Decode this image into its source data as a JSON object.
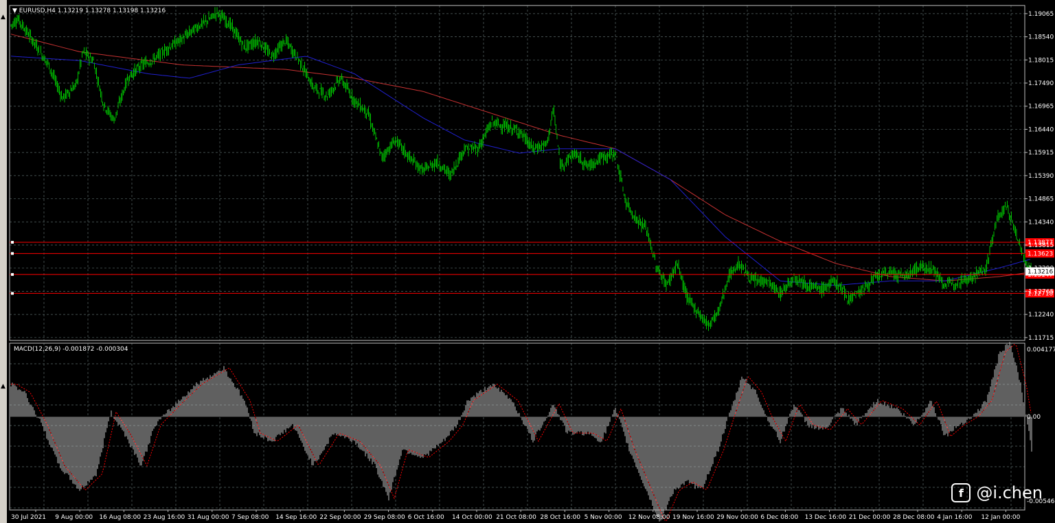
{
  "header": {
    "collapse_icon": "triangle-down-icon",
    "symbol": "EURUSD,H4",
    "quote": "1.13219 1.13278 1.13198 1.13216"
  },
  "price_axis": {
    "ticks": [
      "1.19065",
      "1.18540",
      "1.18015",
      "1.17490",
      "1.16965",
      "1.16440",
      "1.15915",
      "1.15390",
      "1.14865",
      "1.14340",
      "1.13815",
      "1.13290",
      "1.12765",
      "1.12240",
      "1.11715"
    ],
    "current_price": "1.13216"
  },
  "lines": [
    {
      "label": "1.13877",
      "color": "#ff0000"
    },
    {
      "label": "1.13623",
      "color": "#ff0000"
    },
    {
      "label": "1.13147",
      "color": "#ff0000"
    },
    {
      "label": "1.12718",
      "color": "#ff0000"
    }
  ],
  "macd": {
    "label": "MACD(12,26,9) -0.001872 -0.000304",
    "axis": [
      "0.004177",
      "0.00",
      "-0.005461"
    ]
  },
  "time_axis": [
    "30 Jul 2021",
    "9 Aug 00:00",
    "16 Aug 08:00",
    "23 Aug 16:00",
    "31 Aug 00:00",
    "7 Sep 08:00",
    "14 Sep 16:00",
    "22 Sep 00:00",
    "29 Sep 08:00",
    "6 Oct 16:00",
    "14 Oct 00:00",
    "21 Oct 08:00",
    "28 Oct 16:00",
    "5 Nov 00:00",
    "12 Nov 08:00",
    "19 Nov 16:00",
    "29 Nov 00:00",
    "6 Dec 08:00",
    "13 Dec 16:00",
    "21 Dec 00:00",
    "28 Dec 08:00",
    "4 Jan 16:00",
    "12 Jan 00:00"
  ],
  "colors": {
    "candles": "#00c000",
    "ma_fast": "#2020d0",
    "ma_slow": "#c83232",
    "grid": "#5a6a6a",
    "hist": "#c0c0c0",
    "signal": "#ff0000"
  },
  "chart_data": {
    "type": "line",
    "title": "EURUSD,H4",
    "ylim": [
      1.1165,
      1.1925
    ],
    "price_anchors": [
      [
        0,
        1.188
      ],
      [
        10,
        1.1895
      ],
      [
        30,
        1.185
      ],
      [
        55,
        1.179
      ],
      [
        75,
        1.1715
      ],
      [
        95,
        1.1745
      ],
      [
        105,
        1.182
      ],
      [
        120,
        1.18
      ],
      [
        135,
        1.17
      ],
      [
        150,
        1.1665
      ],
      [
        170,
        1.176
      ],
      [
        190,
        1.179
      ],
      [
        205,
        1.18
      ],
      [
        230,
        1.183
      ],
      [
        250,
        1.185
      ],
      [
        270,
        1.1875
      ],
      [
        290,
        1.1895
      ],
      [
        300,
        1.191
      ],
      [
        320,
        1.188
      ],
      [
        340,
        1.183
      ],
      [
        360,
        1.1845
      ],
      [
        380,
        1.181
      ],
      [
        400,
        1.1845
      ],
      [
        420,
        1.18
      ],
      [
        440,
        1.174
      ],
      [
        460,
        1.172
      ],
      [
        480,
        1.176
      ],
      [
        500,
        1.171
      ],
      [
        520,
        1.168
      ],
      [
        540,
        1.158
      ],
      [
        560,
        1.162
      ],
      [
        580,
        1.158
      ],
      [
        600,
        1.155
      ],
      [
        620,
        1.157
      ],
      [
        640,
        1.154
      ],
      [
        660,
        1.16
      ],
      [
        680,
        1.16
      ],
      [
        700,
        1.166
      ],
      [
        720,
        1.165
      ],
      [
        740,
        1.164
      ],
      [
        760,
        1.16
      ],
      [
        780,
        1.161
      ],
      [
        790,
        1.169
      ],
      [
        800,
        1.156
      ],
      [
        820,
        1.159
      ],
      [
        840,
        1.156
      ],
      [
        860,
        1.158
      ],
      [
        880,
        1.159
      ],
      [
        895,
        1.148
      ],
      [
        910,
        1.144
      ],
      [
        925,
        1.142
      ],
      [
        940,
        1.133
      ],
      [
        955,
        1.129
      ],
      [
        970,
        1.134
      ],
      [
        985,
        1.126
      ],
      [
        1000,
        1.123
      ],
      [
        1015,
        1.12
      ],
      [
        1030,
        1.123
      ],
      [
        1045,
        1.131
      ],
      [
        1060,
        1.134
      ],
      [
        1080,
        1.13
      ],
      [
        1100,
        1.13
      ],
      [
        1120,
        1.127
      ],
      [
        1140,
        1.131
      ],
      [
        1160,
        1.129
      ],
      [
        1180,
        1.128
      ],
      [
        1200,
        1.13
      ],
      [
        1220,
        1.126
      ],
      [
        1240,
        1.128
      ],
      [
        1260,
        1.131
      ],
      [
        1280,
        1.132
      ],
      [
        1300,
        1.131
      ],
      [
        1320,
        1.133
      ],
      [
        1340,
        1.133
      ],
      [
        1360,
        1.129
      ],
      [
        1380,
        1.13
      ],
      [
        1400,
        1.131
      ],
      [
        1420,
        1.133
      ],
      [
        1435,
        1.144
      ],
      [
        1450,
        1.147
      ],
      [
        1465,
        1.14
      ],
      [
        1480,
        1.133
      ],
      [
        1486,
        1.1321
      ]
    ],
    "ma_fast": [
      [
        0,
        1.181
      ],
      [
        100,
        1.18
      ],
      [
        200,
        1.177
      ],
      [
        260,
        1.176
      ],
      [
        330,
        1.179
      ],
      [
        430,
        1.181
      ],
      [
        500,
        1.177
      ],
      [
        600,
        1.167
      ],
      [
        660,
        1.162
      ],
      [
        740,
        1.159
      ],
      [
        800,
        1.16
      ],
      [
        880,
        1.16
      ],
      [
        960,
        1.153
      ],
      [
        1040,
        1.14
      ],
      [
        1120,
        1.13
      ],
      [
        1200,
        1.129
      ],
      [
        1280,
        1.13
      ],
      [
        1360,
        1.13
      ],
      [
        1440,
        1.133
      ],
      [
        1486,
        1.135
      ]
    ],
    "ma_slow": [
      [
        0,
        1.186
      ],
      [
        100,
        1.182
      ],
      [
        250,
        1.179
      ],
      [
        400,
        1.178
      ],
      [
        500,
        1.176
      ],
      [
        600,
        1.173
      ],
      [
        700,
        1.168
      ],
      [
        800,
        1.163
      ],
      [
        880,
        1.16
      ],
      [
        960,
        1.153
      ],
      [
        1040,
        1.145
      ],
      [
        1120,
        1.139
      ],
      [
        1200,
        1.134
      ],
      [
        1280,
        1.131
      ],
      [
        1360,
        1.13
      ],
      [
        1440,
        1.131
      ],
      [
        1486,
        1.132
      ]
    ],
    "macd_range": [
      -0.005461,
      0.004177
    ],
    "macd_anchors": [
      [
        0,
        0.002
      ],
      [
        20,
        0.0015
      ],
      [
        45,
        -0.0005
      ],
      [
        70,
        -0.003
      ],
      [
        100,
        -0.0045
      ],
      [
        125,
        -0.0035
      ],
      [
        145,
        0.0003
      ],
      [
        165,
        -0.001
      ],
      [
        190,
        -0.003
      ],
      [
        210,
        -0.0005
      ],
      [
        240,
        0.0008
      ],
      [
        270,
        0.002
      ],
      [
        310,
        0.003
      ],
      [
        340,
        0.001
      ],
      [
        355,
        -0.001
      ],
      [
        380,
        -0.0015
      ],
      [
        410,
        -0.0005
      ],
      [
        440,
        -0.003
      ],
      [
        470,
        -0.001
      ],
      [
        500,
        -0.0015
      ],
      [
        530,
        -0.003
      ],
      [
        550,
        -0.005
      ],
      [
        570,
        -0.002
      ],
      [
        600,
        -0.0025
      ],
      [
        630,
        -0.0015
      ],
      [
        650,
        -0.0005
      ],
      [
        665,
        0.001
      ],
      [
        700,
        0.002
      ],
      [
        730,
        0.001
      ],
      [
        760,
        -0.0015
      ],
      [
        790,
        0.0008
      ],
      [
        810,
        -0.001
      ],
      [
        840,
        -0.001
      ],
      [
        860,
        -0.0015
      ],
      [
        880,
        0.0005
      ],
      [
        900,
        -0.002
      ],
      [
        920,
        -0.004
      ],
      [
        945,
        -0.0065
      ],
      [
        965,
        -0.0045
      ],
      [
        985,
        -0.004
      ],
      [
        1005,
        -0.0045
      ],
      [
        1030,
        -0.002
      ],
      [
        1045,
        0.0
      ],
      [
        1065,
        0.0025
      ],
      [
        1085,
        0.0015
      ],
      [
        1100,
        0.0
      ],
      [
        1120,
        -0.0015
      ],
      [
        1140,
        0.0008
      ],
      [
        1160,
        -0.0005
      ],
      [
        1185,
        -0.0008
      ],
      [
        1210,
        0.0005
      ],
      [
        1230,
        -0.0005
      ],
      [
        1260,
        0.001
      ],
      [
        1290,
        0.0005
      ],
      [
        1315,
        -0.0005
      ],
      [
        1340,
        0.001
      ],
      [
        1360,
        -0.0012
      ],
      [
        1380,
        -0.0005
      ],
      [
        1400,
        0.0
      ],
      [
        1420,
        0.001
      ],
      [
        1440,
        0.004
      ],
      [
        1455,
        0.0045
      ],
      [
        1470,
        0.002
      ],
      [
        1486,
        -0.002
      ]
    ]
  }
}
